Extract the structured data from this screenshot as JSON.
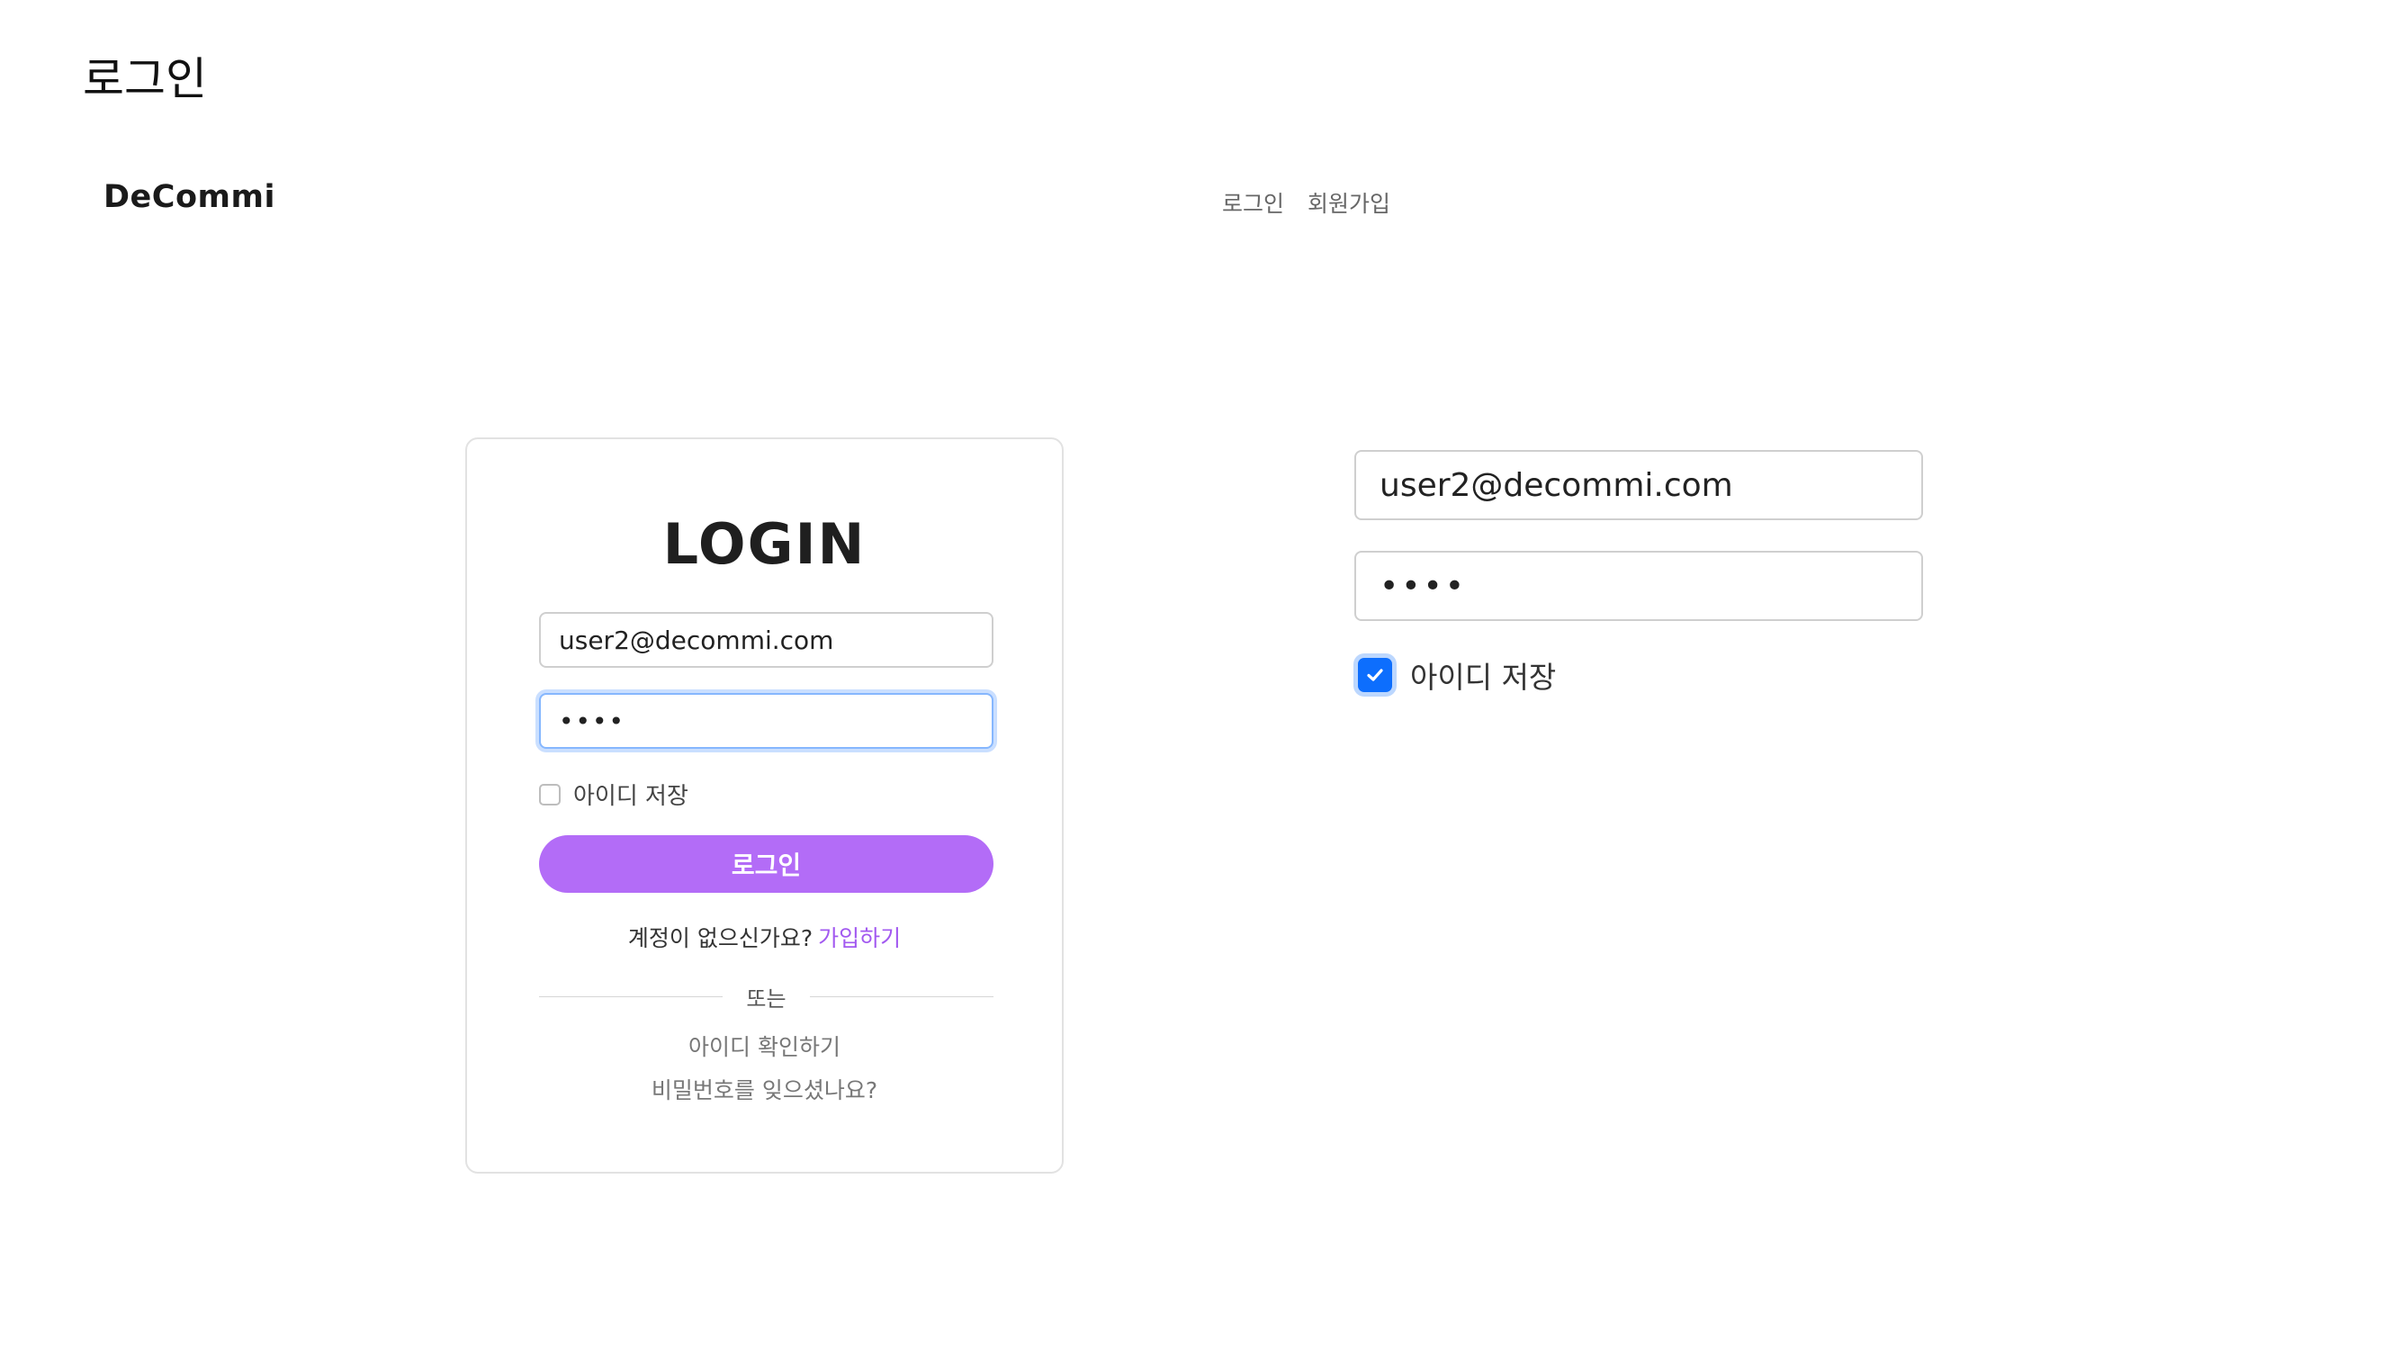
{
  "page": {
    "heading": "로그인"
  },
  "navbar": {
    "logo": "DeCommi",
    "links": [
      "로그인",
      "회원가입"
    ]
  },
  "login_card": {
    "title": "LOGIN",
    "email": {
      "value": "user2@decommi.com"
    },
    "password": {
      "value": "••••",
      "focused": true
    },
    "remember": {
      "label": "아이디 저장",
      "checked": false
    },
    "submit_label": "로그인",
    "signup_prompt": "계정이 없으신가요?",
    "signup_link": "가입하기",
    "divider_text": "또는",
    "find_id_link": "아이디 확인하기",
    "forgot_password_link": "비밀번호를 잊으셨나요?"
  },
  "zoom_detail": {
    "email_value": "user2@decommi.com",
    "password_value": "••••",
    "remember": {
      "label": "아이디 저장",
      "checked": true
    }
  },
  "colors": {
    "accent": "#b36cf7",
    "link": "#a259f0",
    "focus": "#86b7fe",
    "checkbox_checked": "#0d6efd"
  }
}
